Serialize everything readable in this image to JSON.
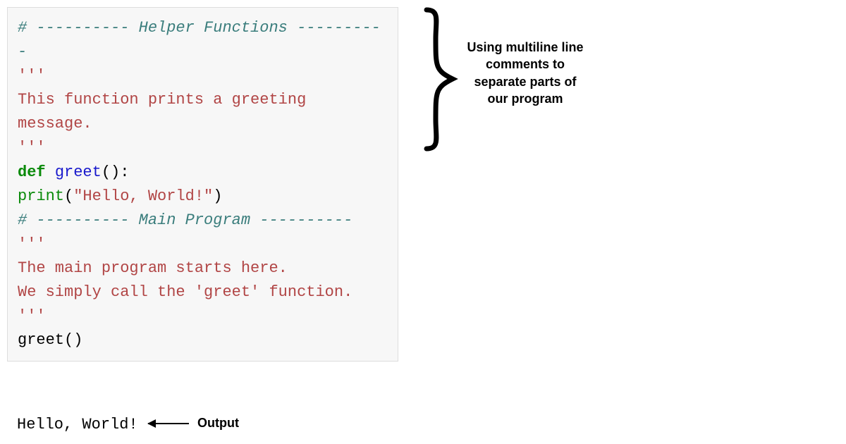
{
  "code": {
    "section1_comment": "# ---------- Helper Functions ----------",
    "blank": " ",
    "docstring_open1": "'''",
    "docstring_line1": "This function prints a greeting message.",
    "docstring_close1": "'''",
    "def_kw": "def",
    "func_name": "greet",
    "def_parens": "():",
    "indent": "    ",
    "print_builtin": "print",
    "print_open": "(",
    "print_string": "\"Hello, World!\"",
    "print_close": ")",
    "section2_comment": "# ---------- Main Program ----------",
    "docstring_open2": "'''",
    "docstring_line2a": "The main program starts here.",
    "docstring_line2b": "We simply call the 'greet' function.",
    "docstring_close2": "'''",
    "call_name": "greet",
    "call_parens": "()"
  },
  "output": {
    "text": "Hello, World!",
    "label": "Output"
  },
  "annotation": {
    "text": "Using multiline line comments to separate parts of our program"
  }
}
